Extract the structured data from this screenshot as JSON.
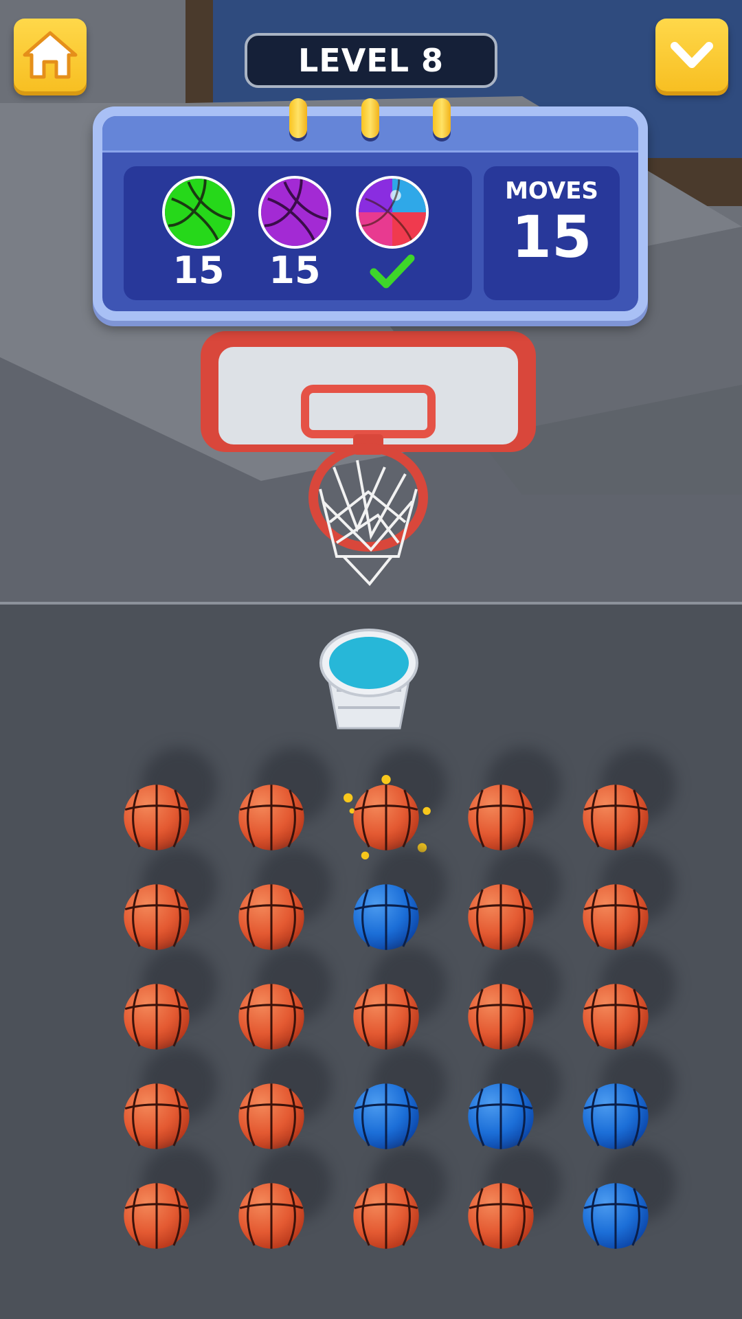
{
  "header": {
    "level_label": "LEVEL 8"
  },
  "goals": [
    {
      "color": "green",
      "count": "15",
      "done": false
    },
    {
      "color": "purple",
      "count": "15",
      "done": false
    },
    {
      "color": "rainbow",
      "count": "",
      "done": true
    }
  ],
  "moves": {
    "label": "MOVES",
    "value": "15"
  },
  "colors": {
    "orange_ball": "#e45a32",
    "blue_ball": "#1c6fd8",
    "green_ball": "#26d81a",
    "purple_ball": "#a32ad4",
    "cup_liquid": "#27b7d8",
    "accent_yellow": "#f7bf22",
    "highlight_yellow": "#f8c81c"
  },
  "icons": [
    "home-icon",
    "chevron-down-icon",
    "checkmark-icon"
  ],
  "grid": {
    "rows": [
      [
        "orange",
        "orange",
        "orange",
        "orange",
        "orange"
      ],
      [
        "orange",
        "orange",
        "blue",
        "orange",
        "orange"
      ],
      [
        "orange",
        "orange",
        "orange",
        "orange",
        "orange"
      ],
      [
        "orange",
        "orange",
        "blue",
        "blue",
        "blue"
      ],
      [
        "orange",
        "orange",
        "orange",
        "orange",
        "blue"
      ]
    ],
    "highlighted": {
      "row": 0,
      "col": 2
    }
  }
}
